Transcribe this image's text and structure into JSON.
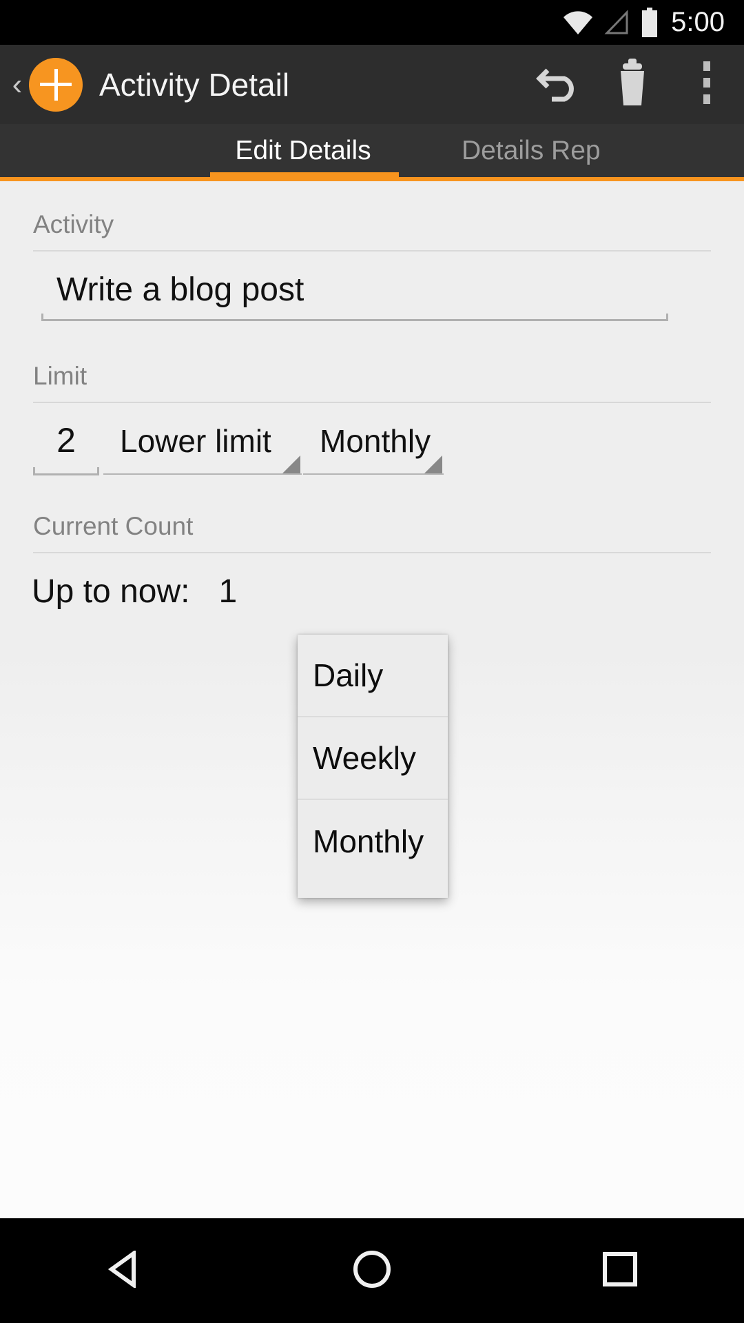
{
  "status_bar": {
    "clock": "5:00",
    "icons": [
      "wifi-icon",
      "cell-signal-icon",
      "battery-icon"
    ]
  },
  "action_bar": {
    "back_label": "‹",
    "logo_icon": "plus-circle-logo",
    "title": "Activity Detail",
    "actions": [
      {
        "name": "undo-button",
        "icon": "undo-icon"
      },
      {
        "name": "delete-button",
        "icon": "trash-icon"
      },
      {
        "name": "overflow-menu-button",
        "icon": "more-vertical-icon"
      }
    ]
  },
  "tabs": {
    "items": [
      {
        "label": "Edit Details",
        "selected": true
      },
      {
        "label": "Details Rep",
        "selected": false
      }
    ],
    "accent_color": "#f7941e"
  },
  "form": {
    "activity": {
      "label": "Activity",
      "value": "Write a blog post",
      "placeholder": "Activity"
    },
    "limit": {
      "label": "Limit",
      "amount": "2",
      "amount_placeholder": "0",
      "type_value": "Lower limit",
      "period_value": "Monthly"
    },
    "current_count": {
      "label": "Current Count",
      "text": "Up to now:",
      "value": "1"
    }
  },
  "dropdown": {
    "open": true,
    "selected": "Monthly",
    "options": [
      "Daily",
      "Weekly",
      "Monthly"
    ]
  },
  "nav_bar": {
    "buttons": [
      {
        "name": "nav-back-button",
        "icon": "triangle-back-icon"
      },
      {
        "name": "nav-home-button",
        "icon": "circle-home-icon"
      },
      {
        "name": "nav-recents-button",
        "icon": "square-recents-icon"
      }
    ]
  },
  "colors": {
    "accent": "#f7941e",
    "action_bar_bg": "#2d2d2d",
    "tab_bar_bg": "#333333",
    "content_bg": "#eeeeee"
  }
}
